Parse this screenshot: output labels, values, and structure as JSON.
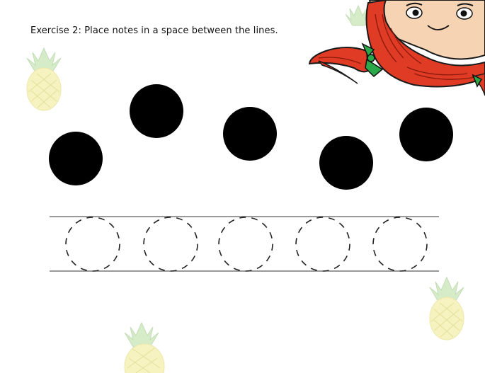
{
  "worksheet": {
    "instructions": "Exercise 2: Place notes in a space between the lines."
  },
  "colors": {
    "note_fill": "#000000",
    "staff_line": "#333333",
    "dashed_circle": "#222222",
    "pineapple_body": "#f6f3c0",
    "pineapple_leaves": "#d6ecc9",
    "hair": "#e03b25",
    "skin": "#f6d3b3",
    "bow": "#2aa84a"
  },
  "icons": [
    "pineapple-icon",
    "girl-character-icon"
  ]
}
